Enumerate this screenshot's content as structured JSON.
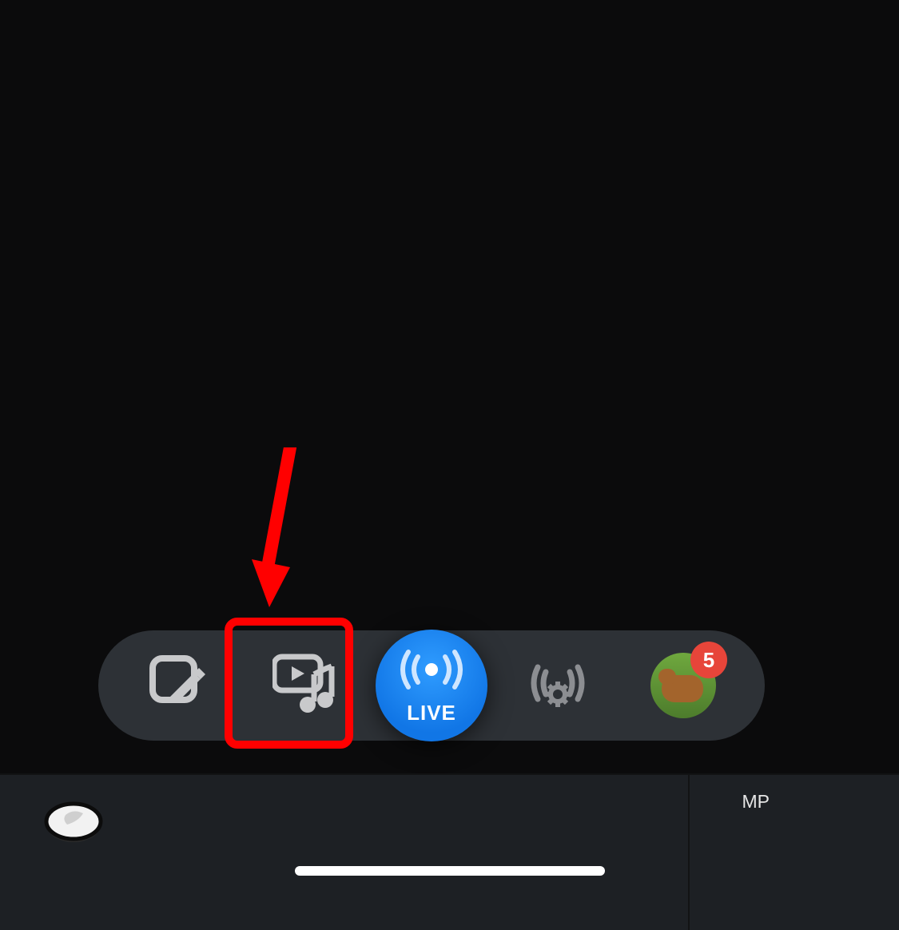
{
  "pill_bar": {
    "items": [
      {
        "name": "compose-button",
        "icon": "compose-note-icon"
      },
      {
        "name": "media-music-button",
        "icon": "media-music-icon",
        "highlighted": true
      },
      {
        "name": "live-button",
        "label": "LIVE",
        "icon": "broadcast-icon"
      },
      {
        "name": "broadcast-settings-button",
        "icon": "broadcast-settings-icon"
      },
      {
        "name": "profile-avatar",
        "badge_count": "5"
      }
    ]
  },
  "bottom_bar": {
    "right_label": "MP"
  },
  "annotation": {
    "arrow_target": "media-music-button"
  },
  "colors": {
    "accent_red": "#ff0000",
    "live_blue": "#1a7de8",
    "badge_red": "#e7453a",
    "bg": "#0b0b0c",
    "pill_bg": "#2d3136",
    "bottom_bg": "#1d2024"
  }
}
